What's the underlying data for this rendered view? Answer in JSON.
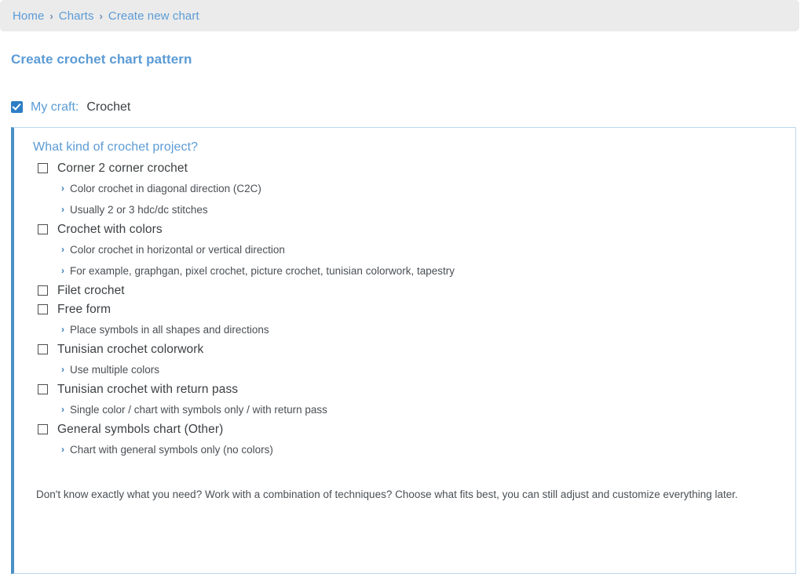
{
  "breadcrumb": {
    "separator": "›",
    "items": [
      {
        "label": "Home"
      },
      {
        "label": "Charts"
      },
      {
        "label": "Create new chart"
      }
    ]
  },
  "page": {
    "title": "Create crochet chart pattern"
  },
  "craft": {
    "checked": true,
    "label": "My craft:",
    "value": "Crochet"
  },
  "panel": {
    "heading": "What kind of crochet project?",
    "chevron": "›",
    "options": [
      {
        "label": "Corner 2 corner crochet",
        "checked": false,
        "details": [
          "Color crochet in diagonal direction (C2C)",
          "Usually 2 or 3 hdc/dc stitches"
        ]
      },
      {
        "label": "Crochet with colors",
        "checked": false,
        "details": [
          "Color crochet in horizontal or vertical direction",
          "For example, graphgan, pixel crochet, picture crochet, tunisian colorwork, tapestry"
        ]
      },
      {
        "label": "Filet crochet",
        "checked": false,
        "details": []
      },
      {
        "label": "Free form",
        "checked": false,
        "details": [
          "Place symbols in all shapes and directions"
        ]
      },
      {
        "label": "Tunisian crochet colorwork",
        "checked": false,
        "details": [
          "Use multiple colors"
        ]
      },
      {
        "label": "Tunisian crochet with return pass",
        "checked": false,
        "details": [
          "Single color / chart with symbols only / with return pass"
        ]
      },
      {
        "label": "General symbols chart (Other)",
        "checked": false,
        "details": [
          "Chart with general symbols only (no colors)"
        ]
      }
    ],
    "note": "Don't know exactly what you need? Work with a combination of techniques? Choose what fits best, you can still adjust and customize everything later."
  },
  "colors": {
    "accent_blue": "#5b9bd5",
    "panel_left_border": "#4a90c4",
    "panel_border": "#bcd8ef",
    "breadcrumb_bg": "#ebebeb",
    "text": "#3c4043",
    "chevron_blue": "#3e7eb8",
    "checkbox_checked_bg": "#2d7dc4"
  }
}
